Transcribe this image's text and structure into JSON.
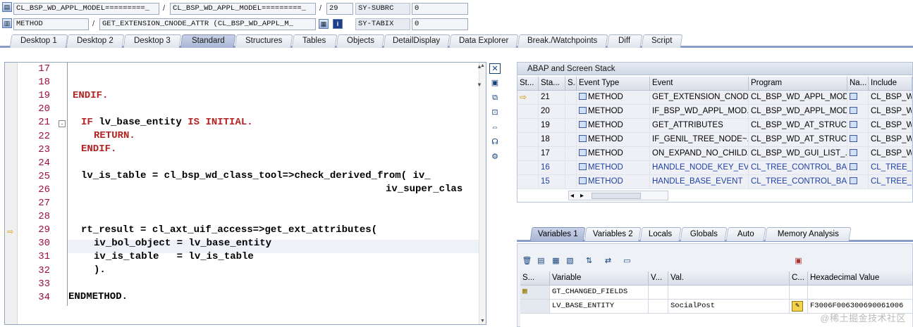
{
  "header": {
    "row1": {
      "field1": "CL_BSP_WD_APPL_MODEL=========_",
      "field2": "CL_BSP_WD_APPL_MODEL=========_",
      "field3": "29",
      "label": "SY-SUBRC",
      "value": "0"
    },
    "row2": {
      "field1": "METHOD",
      "field2": "GET_EXTENSION_CNODE_ATTR (CL_BSP_WD_APPL_M_",
      "label": "SY-TABIX",
      "value": "0"
    },
    "sep": "/"
  },
  "tabs": [
    "Desktop 1",
    "Desktop 2",
    "Desktop 3",
    "Standard",
    "Structures",
    "Tables",
    "Objects",
    "DetailDisplay",
    "Data Explorer",
    "Break./Watchpoints",
    "Diff",
    "Script"
  ],
  "active_tab": "Standard",
  "editor": {
    "line_numbers": [
      "17",
      "18",
      "19",
      "20",
      "21",
      "22",
      "23",
      "24",
      "25",
      "26",
      "27",
      "28",
      "29",
      "30",
      "31",
      "32",
      "33",
      "34"
    ],
    "current_line": "29",
    "code": {
      "l19": "ENDIF.",
      "l21a": "IF",
      "l21b": " lv_base_entity ",
      "l21c": "IS INITIAL.",
      "l22": "RETURN.",
      "l23": "ENDIF.",
      "l25": "lv_is_table = cl_bsp_wd_class_tool=>check_derived_from( iv_",
      "l26": "iv_super_clas",
      "l29": "rt_result = cl_axt_uif_access=>get_ext_attributes(",
      "l30": "iv_bol_object = lv_base_entity",
      "l31": "iv_is_table   = lv_is_table",
      "l32": ").",
      "l34": "ENDMETHOD."
    }
  },
  "stack": {
    "title": "ABAP and Screen Stack",
    "columns": [
      "St...",
      "Sta...",
      "S..",
      "Event Type",
      "Event",
      "Program",
      "Na...",
      "Include"
    ],
    "rows": [
      {
        "level": "21",
        "type": "METHOD",
        "event": "GET_EXTENSION_CNOD...",
        "program": "CL_BSP_WD_APPL_MOD...",
        "include": "CL_BSP_W"
      },
      {
        "level": "20",
        "type": "METHOD",
        "event": "IF_BSP_WD_APPL_MOD...",
        "program": "CL_BSP_WD_APPL_MOD...",
        "include": "CL_BSP_W"
      },
      {
        "level": "19",
        "type": "METHOD",
        "event": "GET_ATTRIBUTES",
        "program": "CL_BSP_WD_AT_STRUC...",
        "include": "CL_BSP_W"
      },
      {
        "level": "18",
        "type": "METHOD",
        "event": "IF_GENIL_TREE_NODE~...",
        "program": "CL_BSP_WD_AT_STRUC...",
        "include": "CL_BSP_W"
      },
      {
        "level": "17",
        "type": "METHOD",
        "event": "ON_EXPAND_NO_CHILD...",
        "program": "CL_BSP_WD_GUI_LIST_...",
        "include": "CL_BSP_W"
      },
      {
        "level": "16",
        "type": "METHOD",
        "event": "HANDLE_NODE_KEY_EV...",
        "program": "CL_TREE_CONTROL_BA...",
        "include": "CL_TREE_"
      },
      {
        "level": "15",
        "type": "METHOD",
        "event": "HANDLE_BASE_EVENT",
        "program": "CL_TREE_CONTROL_BA...",
        "include": "CL_TREE_"
      }
    ],
    "scroll_left": "◂",
    "scroll_right": "▸"
  },
  "var_tabs": [
    "Variables 1",
    "Variables 2",
    "Locals",
    "Globals",
    "Auto",
    "Memory Analysis"
  ],
  "active_var_tab": "Variables 1",
  "variables": {
    "columns": [
      "S...",
      "Variable",
      "V...",
      "Val.",
      "C...",
      "Hexadecimal Value"
    ],
    "rows": [
      {
        "name": "GT_CHANGED_FIELDS",
        "value": "",
        "hex": ""
      },
      {
        "name": "LV_BASE_ENTITY",
        "value": "SocialPost",
        "hex": "F3006F006300690061006"
      }
    ]
  },
  "watermark": "@稀土掘金技术社区"
}
